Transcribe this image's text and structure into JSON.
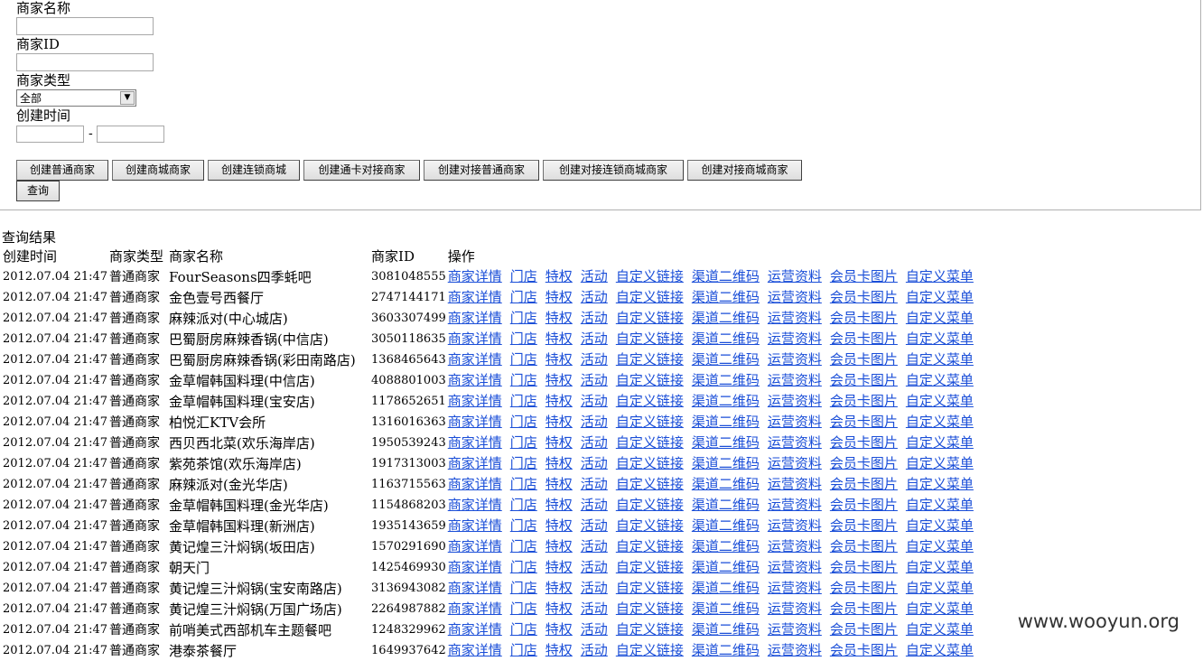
{
  "form": {
    "merchant_name_label": "商家名称",
    "merchant_name_value": "",
    "merchant_id_label": "商家ID",
    "merchant_id_value": "",
    "merchant_type_label": "商家类型",
    "merchant_type_selected": "全部",
    "created_time_label": "创建时间",
    "date_from_value": "",
    "date_to_value": "",
    "date_separator": "-",
    "buttons": [
      "创建普通商家",
      "创建商城商家",
      "创建连锁商城",
      "创建通卡对接商家",
      "创建对接普通商家",
      "创建对接连锁商城商家",
      "创建对接商城商家"
    ],
    "query_button": "查询"
  },
  "results": {
    "title": "查询结果",
    "headers": [
      "创建时间",
      "商家类型",
      "商家名称",
      "商家ID",
      "操作"
    ],
    "actions": [
      "商家详情",
      "门店",
      "特权",
      "活动",
      "自定义链接",
      "渠道二维码",
      "运营资料",
      "会员卡图片",
      "自定义菜单"
    ],
    "rows": [
      {
        "time": "2012.07.04 21:47",
        "type": "普通商家",
        "name": "FourSeasons四季蚝吧",
        "id": "3081048555"
      },
      {
        "time": "2012.07.04 21:47",
        "type": "普通商家",
        "name": "金色壹号西餐厅",
        "id": "2747144171"
      },
      {
        "time": "2012.07.04 21:47",
        "type": "普通商家",
        "name": "麻辣派对(中心城店)",
        "id": "3603307499"
      },
      {
        "time": "2012.07.04 21:47",
        "type": "普通商家",
        "name": "巴蜀厨房麻辣香锅(中信店)",
        "id": "3050118635"
      },
      {
        "time": "2012.07.04 21:47",
        "type": "普通商家",
        "name": "巴蜀厨房麻辣香锅(彩田南路店)",
        "id": "1368465643"
      },
      {
        "time": "2012.07.04 21:47",
        "type": "普通商家",
        "name": "金草帽韩国料理(中信店)",
        "id": "4088801003"
      },
      {
        "time": "2012.07.04 21:47",
        "type": "普通商家",
        "name": "金草帽韩国料理(宝安店)",
        "id": "1178652651"
      },
      {
        "time": "2012.07.04 21:47",
        "type": "普通商家",
        "name": "柏悦汇KTV会所",
        "id": "1316016363"
      },
      {
        "time": "2012.07.04 21:47",
        "type": "普通商家",
        "name": "西贝西北菜(欢乐海岸店)",
        "id": "1950539243"
      },
      {
        "time": "2012.07.04 21:47",
        "type": "普通商家",
        "name": "紫苑茶馆(欢乐海岸店)",
        "id": "1917313003"
      },
      {
        "time": "2012.07.04 21:47",
        "type": "普通商家",
        "name": "麻辣派对(金光华店)",
        "id": "1163715563"
      },
      {
        "time": "2012.07.04 21:47",
        "type": "普通商家",
        "name": "金草帽韩国料理(金光华店)",
        "id": "1154868203"
      },
      {
        "time": "2012.07.04 21:47",
        "type": "普通商家",
        "name": "金草帽韩国料理(新洲店)",
        "id": "1935143659"
      },
      {
        "time": "2012.07.04 21:47",
        "type": "普通商家",
        "name": "黄记煌三汁焖锅(坂田店)",
        "id": "1570291690"
      },
      {
        "time": "2012.07.04 21:47",
        "type": "普通商家",
        "name": "朝天门",
        "id": "1425469930"
      },
      {
        "time": "2012.07.04 21:47",
        "type": "普通商家",
        "name": "黄记煌三汁焖锅(宝安南路店)",
        "id": "3136943082"
      },
      {
        "time": "2012.07.04 21:47",
        "type": "普通商家",
        "name": "黄记煌三汁焖锅(万国广场店)",
        "id": "2264987882"
      },
      {
        "time": "2012.07.04 21:47",
        "type": "普通商家",
        "name": "前哨美式西部机车主题餐吧",
        "id": "1248329962"
      },
      {
        "time": "2012.07.04 21:47",
        "type": "普通商家",
        "name": "港泰茶餐厅",
        "id": "1649937642"
      }
    ]
  },
  "watermark": "www.wooyun.org"
}
